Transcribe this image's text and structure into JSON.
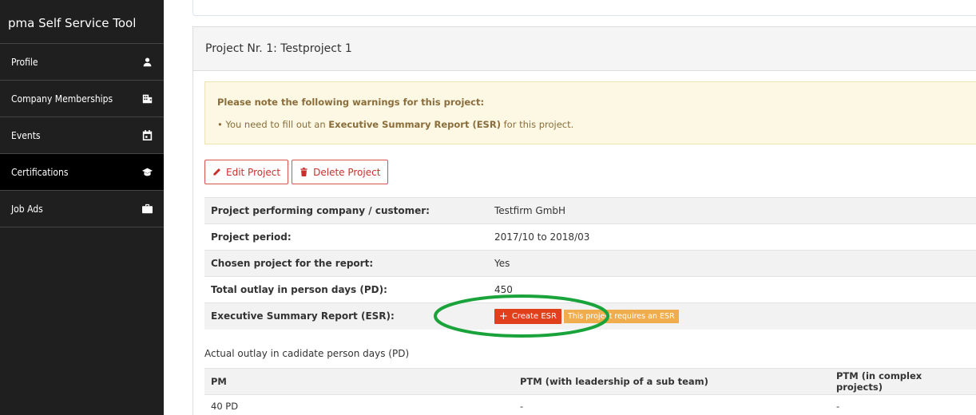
{
  "app": {
    "title": "pma Self Service Tool"
  },
  "sidebar": {
    "items": [
      {
        "label": "Profile",
        "icon": "user-icon",
        "active": false
      },
      {
        "label": "Company Memberships",
        "icon": "building-icon",
        "active": false
      },
      {
        "label": "Events",
        "icon": "calendar-icon",
        "active": false
      },
      {
        "label": "Certifications",
        "icon": "graduation-cap-icon",
        "active": true
      },
      {
        "label": "Job Ads",
        "icon": "briefcase-icon",
        "active": false
      }
    ]
  },
  "project": {
    "heading": "Project Nr. 1: Testproject 1",
    "warning": {
      "header": "Please note the following warnings for this project:",
      "line_prefix": "You need to fill out an ",
      "line_bold": "Executive Summary Report (ESR)",
      "line_suffix": " for this project."
    },
    "buttons": {
      "edit": "Edit Project",
      "delete": "Delete Project"
    },
    "details": {
      "company_label": "Project performing company / customer:",
      "company_value": "Testfirm GmbH",
      "period_label": "Project period:",
      "period_value": "2017/10 to 2018/03",
      "chosen_label": "Chosen project for the report:",
      "chosen_value": "Yes",
      "outlay_label": "Total outlay in person days (PD):",
      "outlay_value": "450",
      "esr_label": "Executive Summary Report (ESR):",
      "esr_button": "Create ESR",
      "esr_badge": "This project requires an ESR"
    },
    "actual_outlay_label": "Actual outlay in cadidate person days (PD)",
    "pd_table": {
      "headers": [
        "PM",
        "PTM (with leadership of a sub team)",
        "PTM (in complex projects)"
      ],
      "row": [
        "40 PD",
        "-",
        "-"
      ]
    }
  },
  "colors": {
    "sidebar_bg": "#1f1f1f",
    "danger": "#d9534f",
    "warning_bg": "#fcf8e3",
    "badge": "#f0ad4e",
    "highlight": "#1aa33a"
  }
}
